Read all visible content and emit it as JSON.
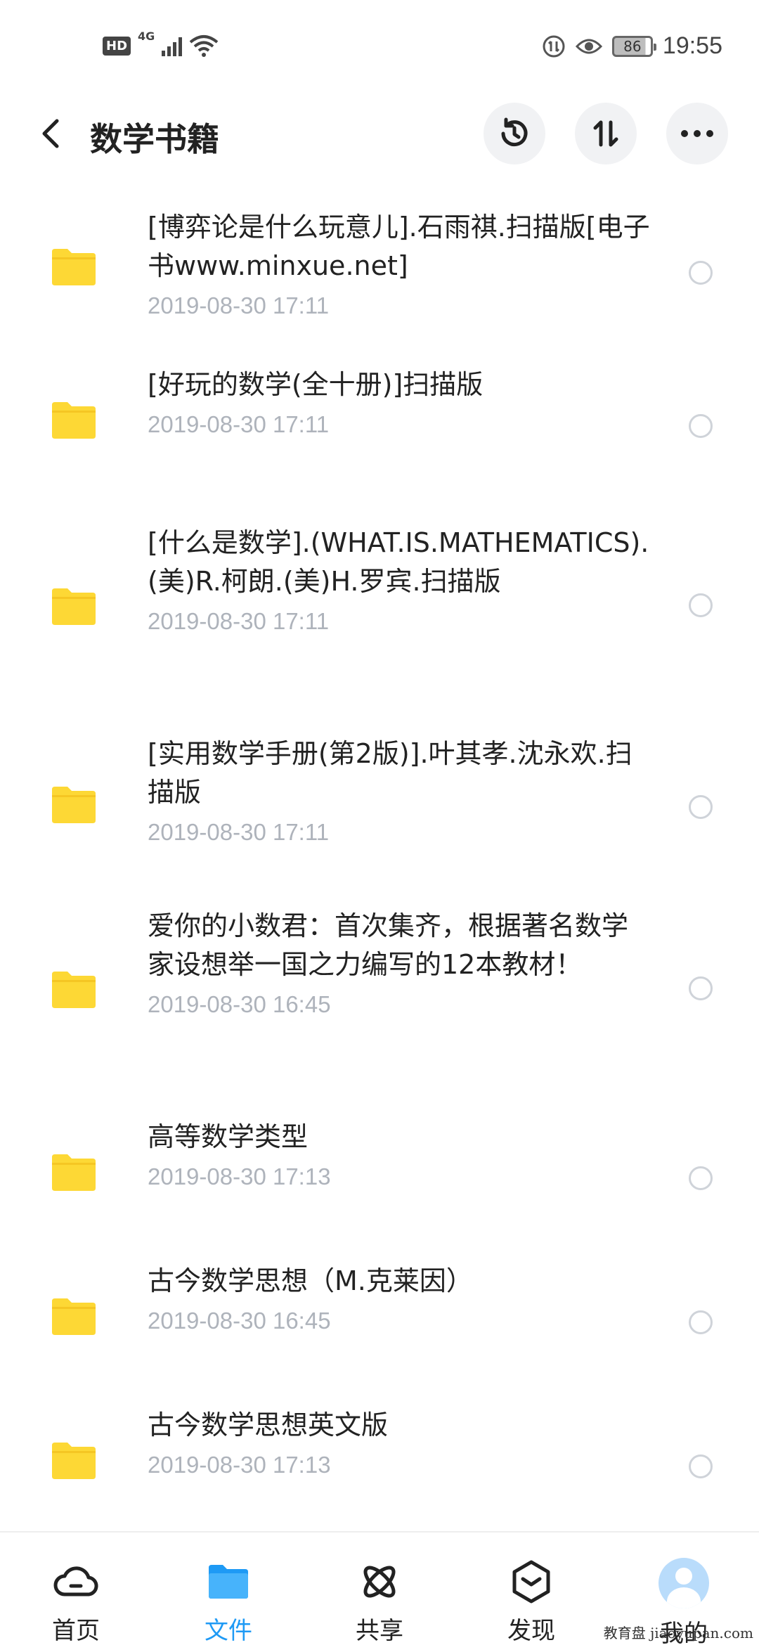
{
  "status_bar": {
    "hd": "HD",
    "network": "4G",
    "battery": "86",
    "time": "19:55"
  },
  "header": {
    "title": "数学书籍"
  },
  "files": [
    {
      "name": "[博弈论是什么玩意儿].石雨祺.扫描版[电子书www.minxue.net]",
      "date": "2019-08-30  17:11"
    },
    {
      "name": "[好玩的数学(全十册)]扫描版",
      "date": "2019-08-30  17:11"
    },
    {
      "name": "[什么是数学].(WHAT.IS.MATHEMATICS).(美)R.柯朗.(美)H.罗宾.扫描版",
      "date": "2019-08-30  17:11"
    },
    {
      "name": "[实用数学手册(第2版)].叶其孝.沈永欢.扫描版",
      "date": "2019-08-30  17:11"
    },
    {
      "name": "爱你的小数君：首次集齐，根据著名数学家设想举一国之力编写的12本教材！",
      "date": "2019-08-30  16:45"
    },
    {
      "name": "高等数学类型",
      "date": "2019-08-30  17:13"
    },
    {
      "name": "古今数学思想（M.克莱因）",
      "date": "2019-08-30  16:45"
    },
    {
      "name": "古今数学思想英文版",
      "date": "2019-08-30  17:13"
    }
  ],
  "bottom_nav": {
    "items": [
      {
        "label": "首页",
        "icon": "cloud-icon"
      },
      {
        "label": "文件",
        "icon": "folder-icon"
      },
      {
        "label": "共享",
        "icon": "share-atom-icon"
      },
      {
        "label": "发现",
        "icon": "discover-cube-icon"
      },
      {
        "label": "我的",
        "icon": "avatar-icon"
      }
    ],
    "active_index": 1
  },
  "watermark": "教育盘 jiaoyupan.com",
  "colors": {
    "accent": "#1e9af5",
    "folder": "#fdd835",
    "date_text": "#aeb3bb"
  }
}
